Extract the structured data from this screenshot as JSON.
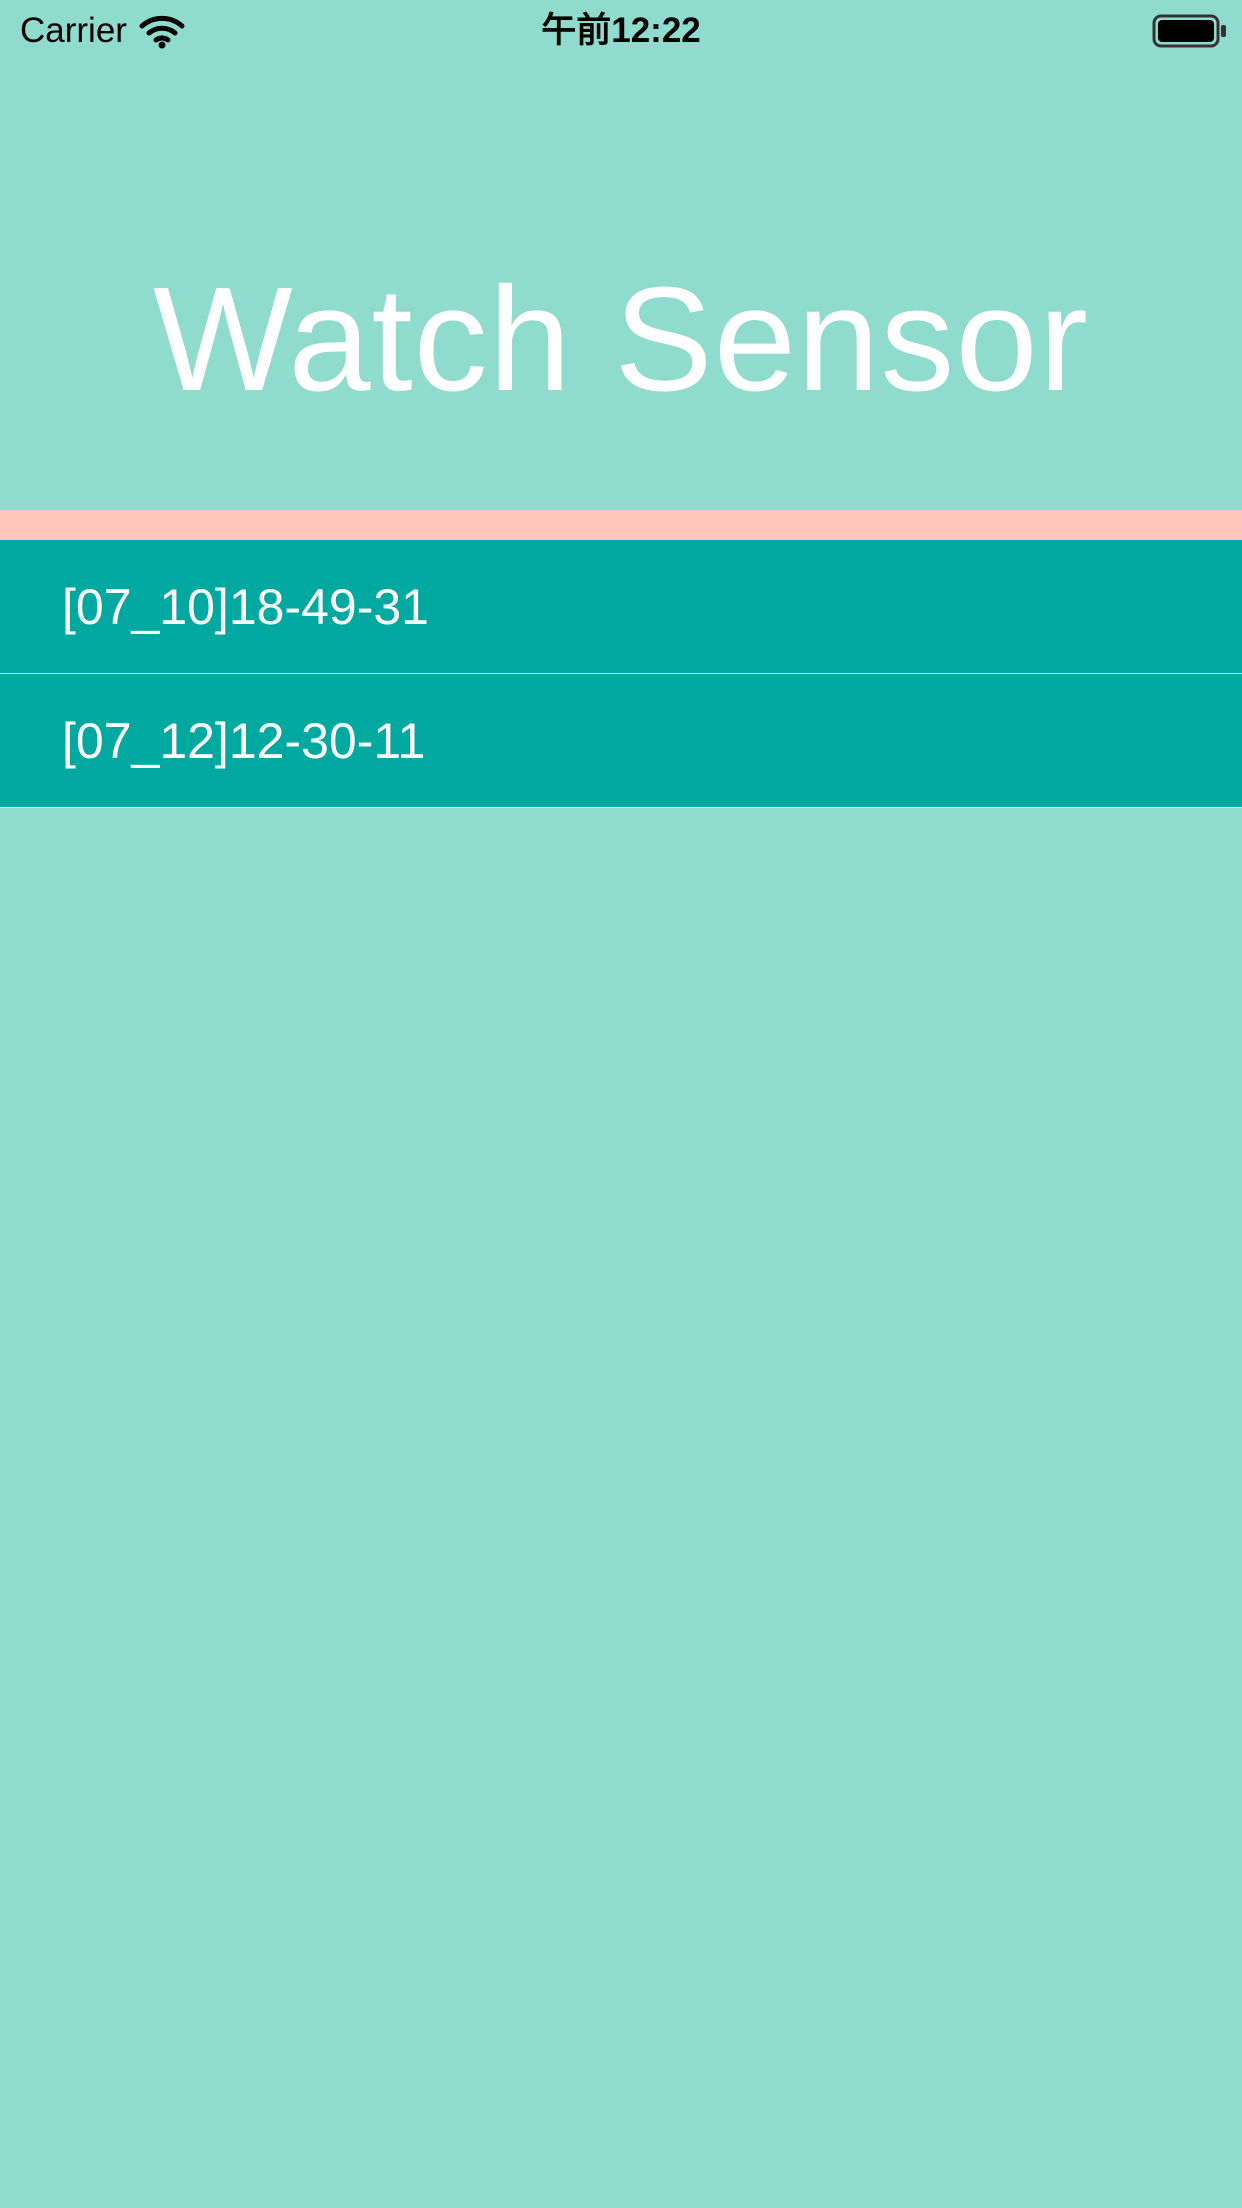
{
  "status_bar": {
    "carrier": "Carrier",
    "time": "午前12:22",
    "wifi_icon": "wifi-icon",
    "battery_icon": "battery-full-icon"
  },
  "header": {
    "title": "Watch Sensor"
  },
  "list": {
    "items": [
      {
        "label": "[07_10]18-49-31"
      },
      {
        "label": "[07_12]12-30-11"
      }
    ]
  },
  "colors": {
    "background": "#8fdccf",
    "accent_strip": "#ffc6bd",
    "list_item": "#00a9a0",
    "title_text": "#ffffff"
  }
}
